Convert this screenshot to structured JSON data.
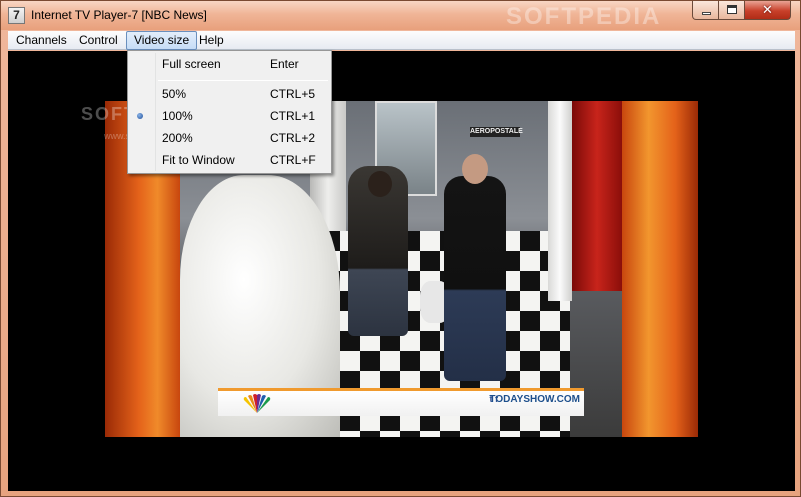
{
  "window": {
    "app_icon_glyph": "7",
    "title": "Internet TV Player-7  [NBC News]",
    "watermark": "SOFTPEDIA",
    "minimize_glyph": "",
    "maximize_glyph": "",
    "close_glyph": "✕"
  },
  "menubar": {
    "items": [
      {
        "label": "Channels"
      },
      {
        "label": "Control"
      },
      {
        "label": "Video size",
        "active": true
      },
      {
        "label": "Help"
      }
    ]
  },
  "video_size_menu": {
    "items": [
      {
        "label": "Full screen",
        "accelerator": "Enter",
        "checked": false
      },
      {
        "label": "50%",
        "accelerator": "CTRL+5",
        "checked": false
      },
      {
        "label": "100%",
        "accelerator": "CTRL+1",
        "checked": true
      },
      {
        "label": "200%",
        "accelerator": "CTRL+2",
        "checked": false
      },
      {
        "label": "Fit to Window",
        "accelerator": "CTRL+F",
        "checked": false
      }
    ]
  },
  "video": {
    "store_sign": "AEROPOSTALE",
    "social_icons": "t f",
    "ticker_text": "TODAYSHOW.COM",
    "watermark": "SOFTPEDIA",
    "watermark_url": "www.softpedia.com"
  },
  "colors": {
    "title_bar": "#f0b597",
    "close_button": "#c8402a",
    "menu_highlight": "#c6dcf6",
    "radio_checked": "#1f4f9a",
    "ticker_accent": "#f09a2e"
  }
}
